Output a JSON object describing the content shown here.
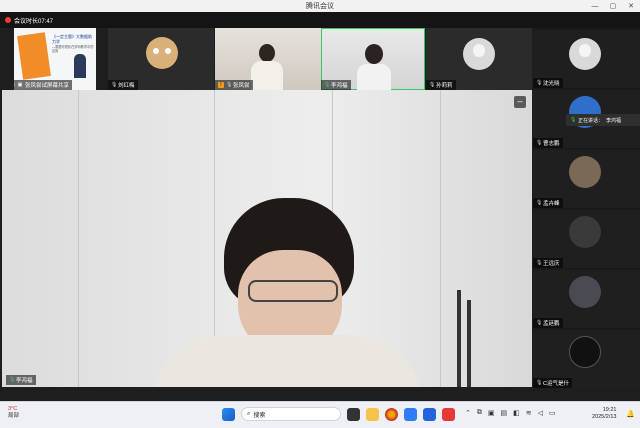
{
  "window": {
    "title": "腾讯会议",
    "controls": [
      "—",
      "▢",
      "✕"
    ]
  },
  "meeting": {
    "status_text": "会议时长07:47",
    "collapse_icon": "minus-icon"
  },
  "top_strip": [
    {
      "id": "t1",
      "name": "张凤尝试屏幕共享",
      "type": "slides",
      "slide_title": "《一定主题》大数据助力学",
      "slide_sub": "—数据可视化在学科教学中的应用"
    },
    {
      "id": "t2",
      "name": "刘红梅",
      "type": "cartoon-avatar"
    },
    {
      "id": "t3",
      "name": "张凤尝",
      "type": "video"
    },
    {
      "id": "t4",
      "name": "李鸿福",
      "type": "video",
      "active": true
    },
    {
      "id": "t5",
      "name": "孙莉莉",
      "type": "placeholder-avatar"
    }
  ],
  "main_speaker": {
    "name": "李鸿福"
  },
  "side_panel": [
    {
      "name": "沈光晓",
      "type": "placeholder-avatar"
    },
    {
      "name": "曹志鹏",
      "type": "image-avatar"
    },
    {
      "name": "孟卉峰",
      "type": "image-avatar"
    },
    {
      "name": "王远庆",
      "type": "image-avatar"
    },
    {
      "name": "孟廷鹏",
      "type": "image-avatar"
    },
    {
      "name": "C运气是什",
      "type": "image-avatar"
    }
  ],
  "speaking_indicator": {
    "label": "正在讲话：",
    "name": "李鸿福"
  },
  "taskbar": {
    "weather_temp": "3°C",
    "weather_desc": "局部",
    "search_placeholder": "搜索",
    "time": "19:21",
    "date": "2025/2/13"
  },
  "colors": {
    "active_border": "#37c966",
    "mic_active": "#3fd06a",
    "record_dot": "#ff3b30"
  }
}
